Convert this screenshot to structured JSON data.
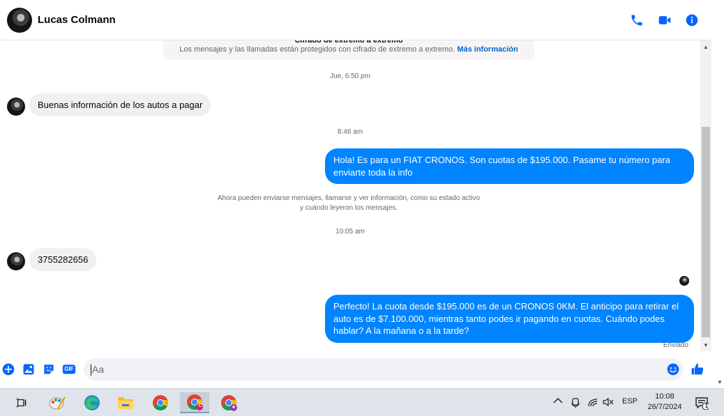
{
  "window": {
    "contact_name": "Lucas Colmann"
  },
  "header": {
    "call_icon": "phone-icon",
    "video_icon": "video-camera-icon",
    "info_icon": "info-icon"
  },
  "banner": {
    "title": "Cifrado de extremo a extremo",
    "text": "Los mensajes y las llamadas están protegidos con cifrado de extremo a extremo.",
    "link": "Más información"
  },
  "messages": [
    {
      "type": "timestamp",
      "text": "Jue, 6:50 pm"
    },
    {
      "type": "incoming",
      "text": "Buenas información de los autos a pagar"
    },
    {
      "type": "timestamp",
      "text": "8:46 am"
    },
    {
      "type": "outgoing",
      "text": "Hola! Es para un FIAT CRONOS. Son cuotas de $195.000. Pasame tu número para enviarte toda la info"
    },
    {
      "type": "notice",
      "line1": "Ahora pueden enviarse mensajes, llamarse y ver información, como su estado activo",
      "line2": "y cuándo leyeron los mensajes."
    },
    {
      "type": "timestamp",
      "text": "10:05 am"
    },
    {
      "type": "incoming",
      "text": "3755282656"
    },
    {
      "type": "outgoing",
      "text": "Perfecto! La cuota desde $195.000 es de un CRONOS 0KM. El anticipo para retirar el auto es de $7.100.000, mientras tanto podes ir pagando en cuotas. Cuándo podes hablar? A la mañana o a la tarde?"
    }
  ],
  "delivery_status": "Enviado",
  "composer": {
    "placeholder": "Aa",
    "icons": [
      "plus-icon",
      "image-icon",
      "sticker-icon",
      "gif-icon",
      "emoji-icon",
      "thumbs-up-icon"
    ],
    "gif_label": "GIF"
  },
  "taskbar": {
    "apps": [
      "task-view-icon",
      "paint-icon",
      "edge-icon",
      "file-explorer-icon",
      "chrome-icon",
      "chrome-profile-c-icon",
      "chrome-profile-2-icon"
    ],
    "profile_badge": "C",
    "language": "ESP",
    "time": "10:08",
    "date": "26/7/2024",
    "notification_count": "1"
  },
  "colors": {
    "accent": "#0084ff",
    "icon_blue": "#0866ff",
    "bubble_in": "#f0f0f0",
    "link": "#0064d1"
  }
}
